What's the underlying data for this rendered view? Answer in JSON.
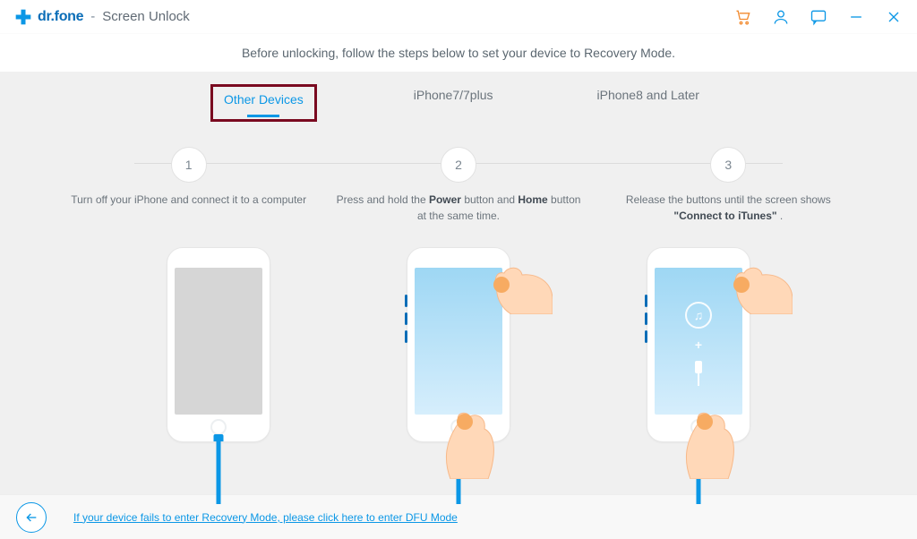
{
  "app": {
    "brand": "dr.fone",
    "separator": "-",
    "page_title": "Screen Unlock"
  },
  "instruction": "Before unlocking, follow the steps below to set your device to Recovery Mode.",
  "tabs": {
    "other": "Other Devices",
    "iphone7": "iPhone7/7plus",
    "iphone8": "iPhone8 and Later"
  },
  "steps": {
    "s1": {
      "num": "1",
      "text": "Turn off your iPhone and connect it to a computer"
    },
    "s2": {
      "num": "2",
      "prefix": "Press and hold the ",
      "bold1": "Power",
      "mid": " button and ",
      "bold2": "Home",
      "suffix": " button at the same time."
    },
    "s3": {
      "num": "3",
      "prefix": "Release the buttons until the screen shows ",
      "bold1": "\"Connect to iTunes\"",
      "suffix": " ."
    }
  },
  "footer": {
    "dfu_link": "If your device fails to enter Recovery Mode, please click here to enter DFU Mode"
  }
}
